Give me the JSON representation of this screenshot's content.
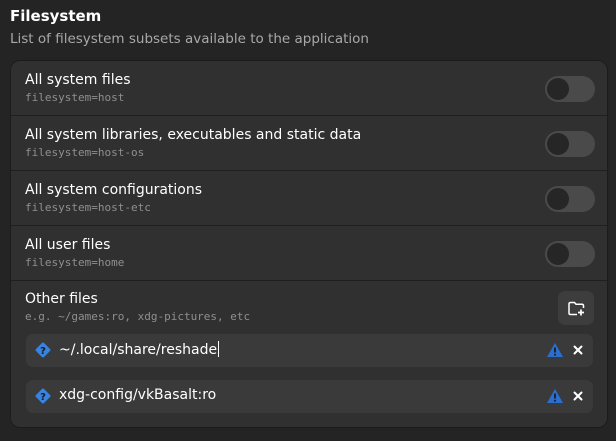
{
  "section": {
    "title": "Filesystem",
    "subtitle": "List of filesystem subsets available to the application"
  },
  "rows": [
    {
      "title": "All system files",
      "subtitle": "filesystem=host",
      "enabled": false
    },
    {
      "title": "All system libraries, executables and static data",
      "subtitle": "filesystem=host-os",
      "enabled": false
    },
    {
      "title": "All system configurations",
      "subtitle": "filesystem=host-etc",
      "enabled": false
    },
    {
      "title": "All user files",
      "subtitle": "filesystem=home",
      "enabled": false
    }
  ],
  "other_files": {
    "title": "Other files",
    "subtitle": "e.g. ~/games:ro, xdg-pictures, etc",
    "add_icon": "folder-add-icon",
    "entries": [
      {
        "value": "~/.local/share/reshade",
        "icon": "question-icon",
        "warning_icon": "warning-icon",
        "remove_icon": "close-icon"
      },
      {
        "value": "xdg-config/vkBasalt:ro",
        "icon": "question-icon",
        "warning_icon": "warning-icon",
        "remove_icon": "close-icon"
      }
    ]
  },
  "colors": {
    "background": "#242424",
    "card": "#303030",
    "entry": "#3a3a3a",
    "toggle_off": "#4a4a4a",
    "accent_blue": "#3584e4",
    "warning_blue": "#2a6fd0"
  }
}
